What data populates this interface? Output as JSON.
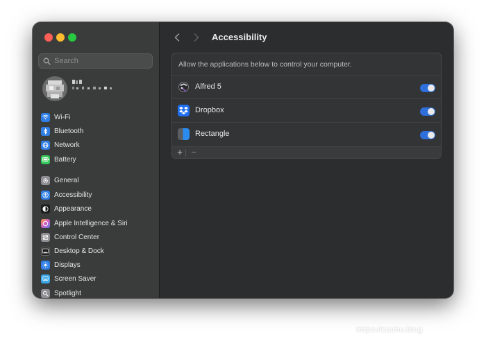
{
  "window": {
    "title": "Accessibility",
    "traffic_lights": [
      "#ff5f57",
      "#febc2e",
      "#28c840"
    ]
  },
  "sidebar": {
    "search_placeholder": "Search",
    "account_name": "",
    "groups": [
      [
        {
          "label": "Wi-Fi",
          "icon": "wifi-icon",
          "color": "#2f7ee6"
        },
        {
          "label": "Bluetooth",
          "icon": "bluetooth-icon",
          "color": "#2f7ee6"
        },
        {
          "label": "Network",
          "icon": "globe-icon",
          "color": "#2f7ee6"
        },
        {
          "label": "Battery",
          "icon": "battery-icon",
          "color": "#34c759"
        }
      ],
      [
        {
          "label": "General",
          "icon": "gear-icon",
          "color": "#8e8e93"
        },
        {
          "label": "Accessibility",
          "icon": "accessibility-icon",
          "color": "#2f7ee6"
        },
        {
          "label": "Appearance",
          "icon": "appearance-icon",
          "color": "#1c1c1e"
        },
        {
          "label": "Apple Intelligence & Siri",
          "icon": "siri-icon",
          "color": "#d45cc2"
        },
        {
          "label": "Control Center",
          "icon": "control-center-icon",
          "color": "#8e8e93"
        },
        {
          "label": "Desktop & Dock",
          "icon": "dock-icon",
          "color": "#1c1c1e"
        },
        {
          "label": "Displays",
          "icon": "displays-icon",
          "color": "#2f7ee6"
        },
        {
          "label": "Screen Saver",
          "icon": "screen-saver-icon",
          "color": "#3aa7e8"
        },
        {
          "label": "Spotlight",
          "icon": "spotlight-icon",
          "color": "#8e8e93"
        }
      ]
    ]
  },
  "main": {
    "description": "Allow the applications below to control your computer.",
    "apps": [
      {
        "name": "Alfred 5",
        "icon": "alfred-icon",
        "enabled": true
      },
      {
        "name": "Dropbox",
        "icon": "dropbox-icon",
        "enabled": true
      },
      {
        "name": "Rectangle",
        "icon": "rectangle-icon",
        "enabled": true
      }
    ],
    "add_label": "+",
    "remove_label": "−"
  },
  "watermark": "https://zouhu.blog"
}
